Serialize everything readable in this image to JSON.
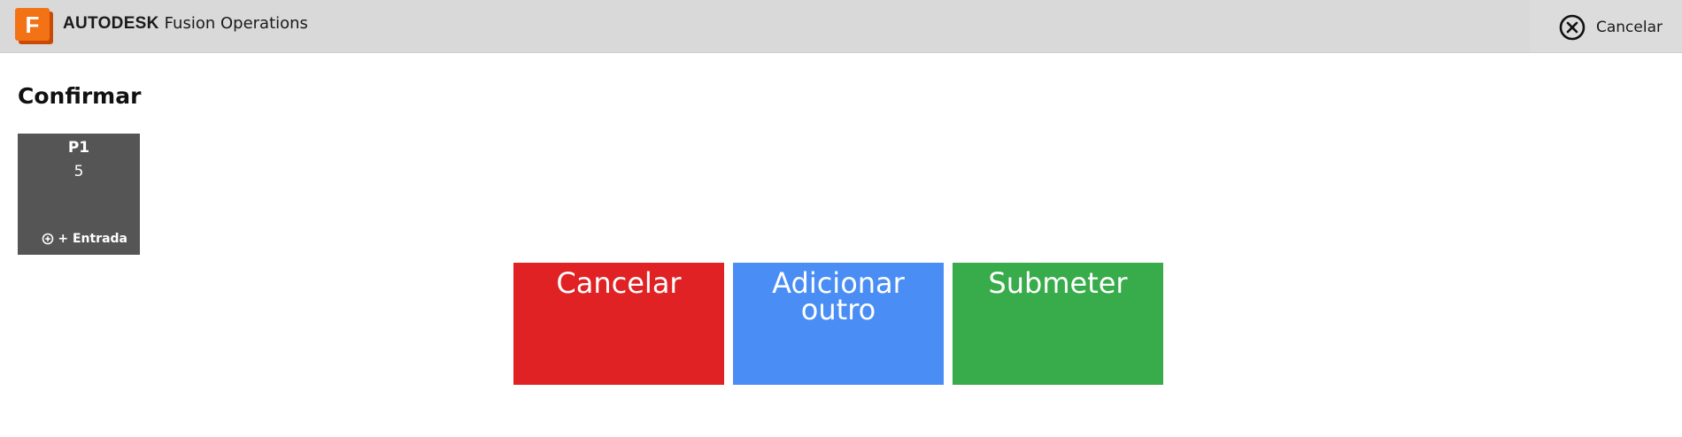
{
  "header": {
    "company": "AUTODESK",
    "product": "Fusion Operations",
    "logo_letter": "F",
    "logo_icon": "fusion-logo-icon",
    "cancel_icon": "close-circle-icon",
    "cancel_label": "Cancelar"
  },
  "page": {
    "title": "Confirmar"
  },
  "tile": {
    "title": "P1",
    "value": "5",
    "entry_icon": "add-circle-icon",
    "entry_label": "+ Entrada",
    "background": "#555555"
  },
  "actions": {
    "cancel_label": "Cancelar",
    "add_line1": "Adicionar",
    "add_line2": "outro",
    "submit_label": "Submeter",
    "colors": {
      "cancel": "#e02225",
      "add": "#4a8ef5",
      "submit": "#38ab4a"
    }
  }
}
